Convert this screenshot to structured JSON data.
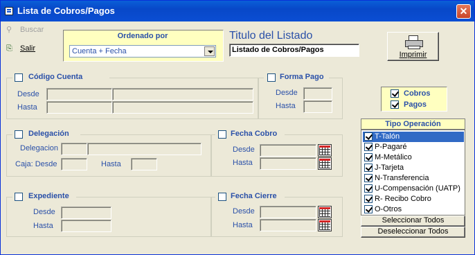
{
  "window": {
    "title": "Lista de Cobros/Pagos"
  },
  "toolbar": {
    "buscar_label": "Buscar",
    "salir_label": "Salir"
  },
  "ordenado": {
    "label": "Ordenado por",
    "value": "Cuenta + Fecha"
  },
  "titulo": {
    "label": "Titulo del Listado",
    "value": "Listado de Cobros/Pagos"
  },
  "imprimir_label": "Imprimir",
  "codigo_cuenta": {
    "label": "Código Cuenta",
    "desde": "Desde",
    "hasta": "Hasta"
  },
  "forma_pago": {
    "label": "Forma Pago",
    "desde": "Desde",
    "hasta": "Hasta"
  },
  "tipo_cp": {
    "cobros": "Cobros",
    "pagos": "Pagos"
  },
  "delegacion": {
    "label": "Delegación",
    "delegacion": "Delegacion",
    "caja_desde": "Caja: Desde",
    "hasta": "Hasta"
  },
  "fecha_cobro": {
    "label": "Fecha Cobro",
    "desde": "Desde",
    "hasta": "Hasta"
  },
  "expediente": {
    "label": "Expediente",
    "desde": "Desde",
    "hasta": "Hasta"
  },
  "fecha_cierre": {
    "label": "Fecha Cierre",
    "desde": "Desde",
    "hasta": "Hasta"
  },
  "tipo_operacion": {
    "header": "Tipo Operación",
    "items": [
      "T-Talón",
      "P-Pagaré",
      "M-Metálico",
      "J-Tarjeta",
      "N-Transferencia",
      "U-Compensación (UATP)",
      "R- Recibo Cobro",
      "O-Otros"
    ],
    "select_all": "Seleccionar Todos",
    "deselect_all": "Deseleccionar Todos"
  }
}
